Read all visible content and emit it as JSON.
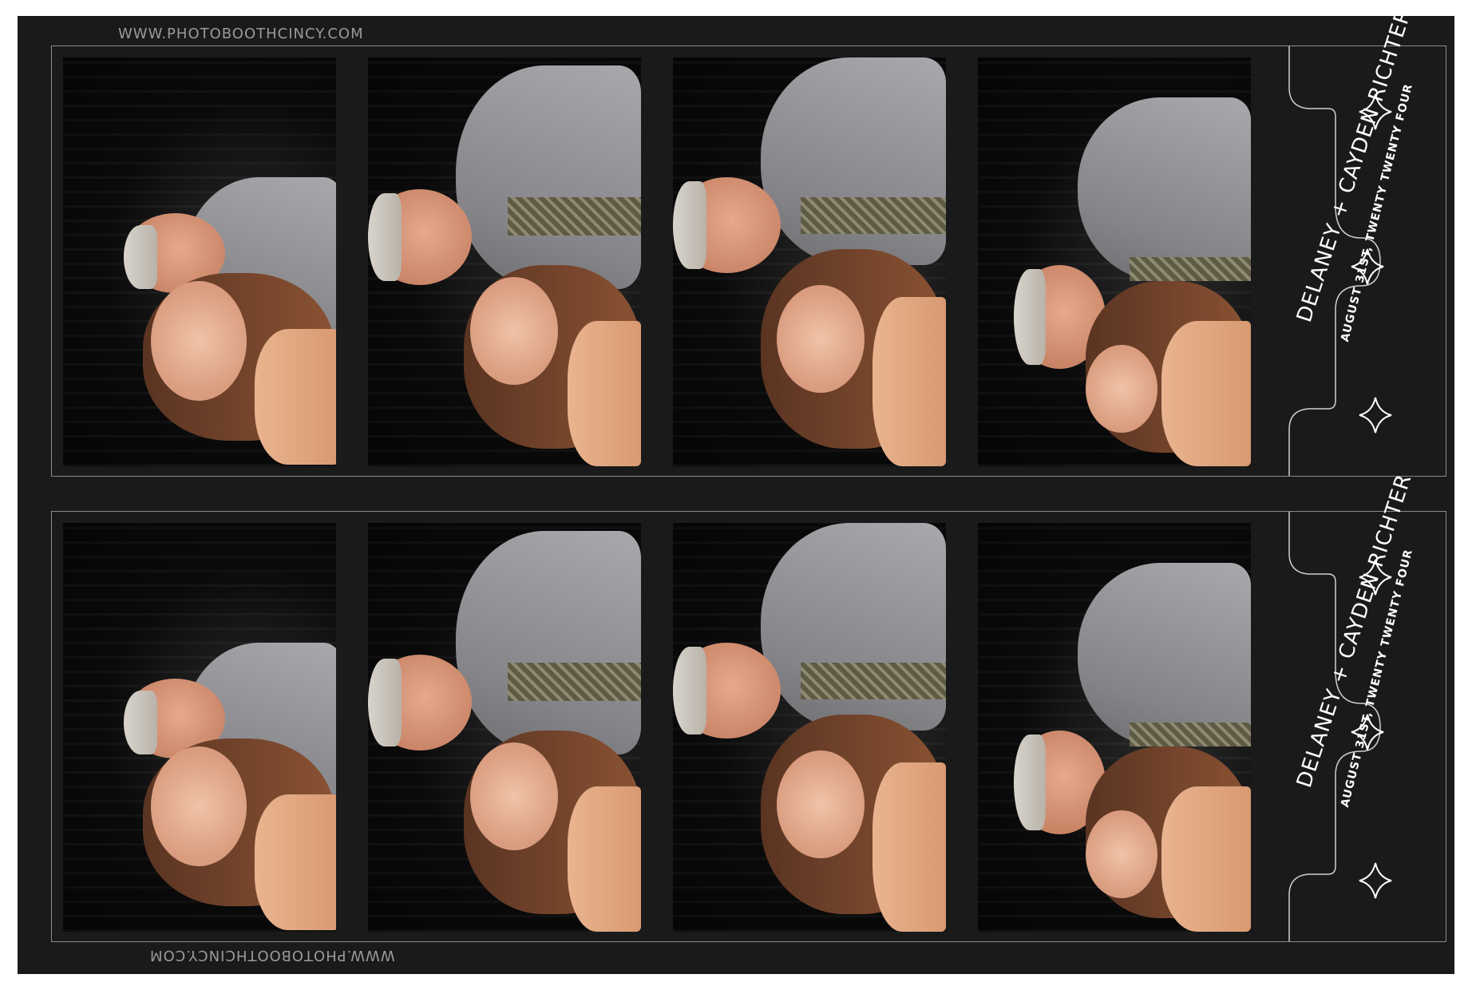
{
  "watermark": {
    "top": "WWW.PHOTOBOOTHCINCY.COM",
    "bottom": "WWW.PHOTOBOOTHCINCY.COM"
  },
  "strip": {
    "names": "DELANEY + CAYDEN RICHTER",
    "date": "AUGUST 31ST, TWENTY TWENTY FOUR",
    "sparkle_icon": "four-point-star-icon"
  },
  "colors": {
    "background": "#1a1a1b",
    "border": "#8a8a8a",
    "text": "#ffffff"
  }
}
